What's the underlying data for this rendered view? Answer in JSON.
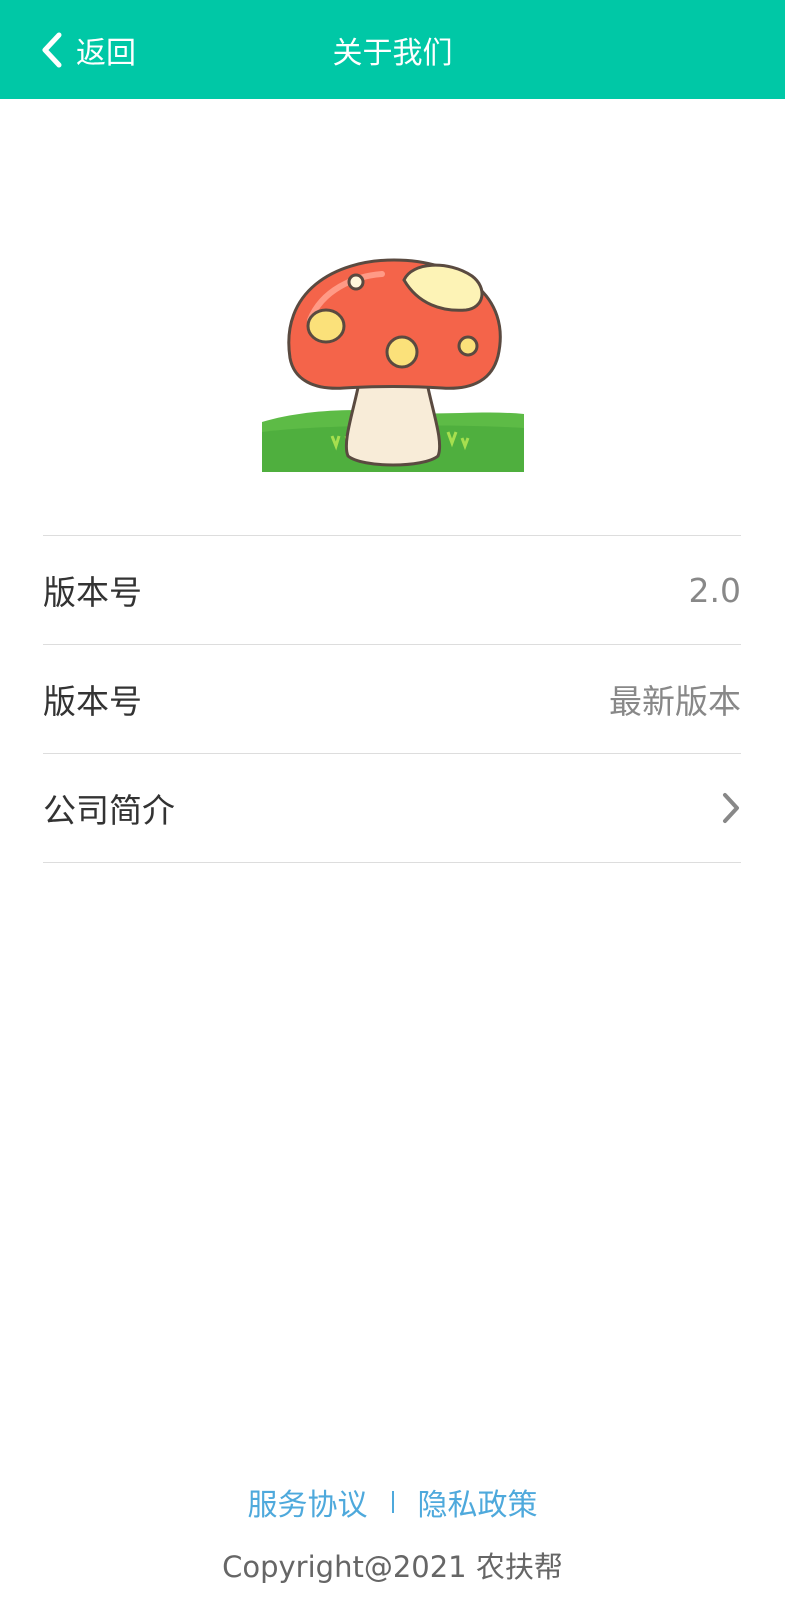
{
  "header": {
    "back_label": "返回",
    "title": "关于我们",
    "background": "#00c8a6"
  },
  "logo": {
    "icon": "mushroom-icon"
  },
  "rows": [
    {
      "label": "版本号",
      "value": "2.0"
    },
    {
      "label": "版本号",
      "value": "最新版本"
    },
    {
      "label": "公司简介",
      "icon": "chevron-right-icon"
    }
  ],
  "footer": {
    "service_agreement": "服务协议",
    "privacy_policy": "隐私政策",
    "copyright": "Copyright@2021 农扶帮",
    "link_color": "#4ea9dc"
  }
}
